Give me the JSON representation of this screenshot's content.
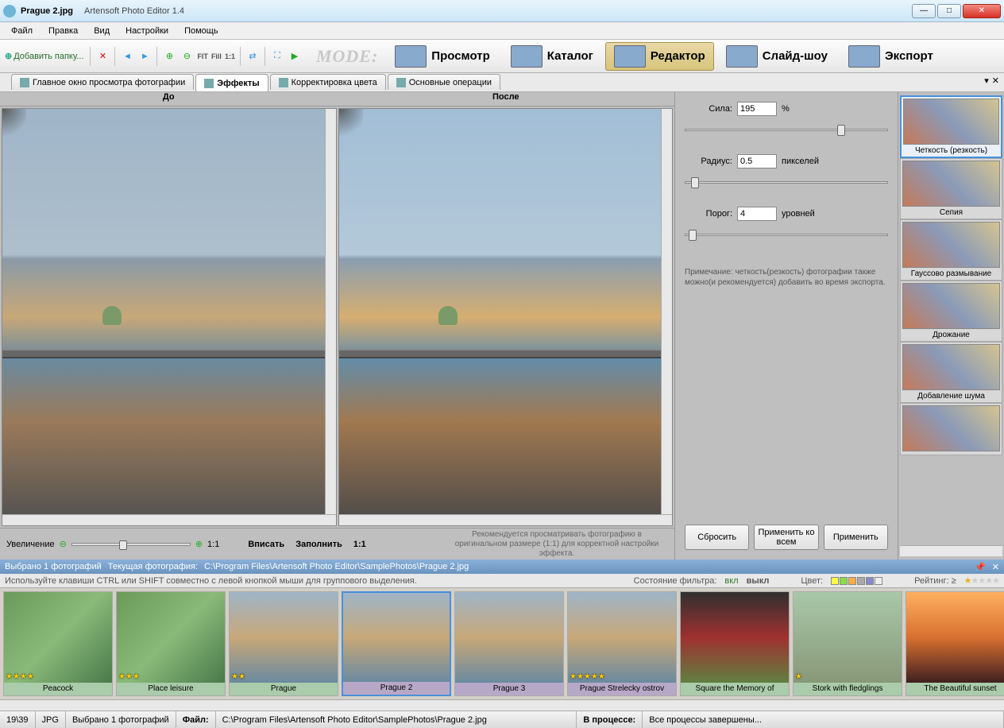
{
  "title": {
    "filename": "Prague 2.jpg",
    "app": "Artensoft Photo Editor 1.4"
  },
  "menu": [
    "Файл",
    "Правка",
    "Вид",
    "Настройки",
    "Помощь"
  ],
  "toolbar": {
    "addfolder": "Добавить папку...",
    "fit": "FIT",
    "fill": "Fill",
    "oneone": "1:1",
    "modelabel": "MODE:",
    "modes": [
      {
        "name": "Просмотр"
      },
      {
        "name": "Каталог"
      },
      {
        "name": "Редактор",
        "active": true
      },
      {
        "name": "Слайд-шоу"
      },
      {
        "name": "Экспорт"
      }
    ]
  },
  "tabs": [
    {
      "label": "Главное окно просмотра фотографии"
    },
    {
      "label": "Эффекты",
      "active": true
    },
    {
      "label": "Корректировка цвета"
    },
    {
      "label": "Основные операции"
    }
  ],
  "preview": {
    "before": "До",
    "after": "После"
  },
  "zoom": {
    "label": "Увеличение",
    "oneone": "1:1",
    "fit": "Вписать",
    "fill": "Заполнить",
    "scale": "1:1",
    "hint": "Рекомендуется просматривать фотографию в оригинальном размере (1:1) для корректной настройки эффекта."
  },
  "controls": {
    "strength": {
      "label": "Сила:",
      "value": "195",
      "unit": "%",
      "pos": 75
    },
    "radius": {
      "label": "Радиус:",
      "value": "0.5",
      "unit": "пикселей",
      "pos": 3
    },
    "threshold": {
      "label": "Порог:",
      "value": "4",
      "unit": "уровней",
      "pos": 2
    },
    "note": "Примечание: четкость(резкость) фотографии также можно(и рекомендуется) добавить во время экспорта.",
    "reset": "Сбросить",
    "applyall": "Применить ко всем",
    "apply": "Применить"
  },
  "effects": [
    {
      "name": "Четкость (резкость)",
      "sel": true
    },
    {
      "name": "Сепия"
    },
    {
      "name": "Гауссово размывание"
    },
    {
      "name": "Дрожание"
    },
    {
      "name": "Добавление шума"
    },
    {
      "name": ""
    }
  ],
  "strip": {
    "header": {
      "selected": "Выбрано 1  фотографий",
      "current": "Текущая фотография:",
      "path": "C:\\Program Files\\Artensoft Photo Editor\\SamplePhotos\\Prague 2.jpg"
    },
    "filter": {
      "hint": "Используйте клавиши CTRL или SHIFT совместно с левой кнопкой мыши для группового выделения.",
      "state": "Состояние фильтра:",
      "on": "вкл",
      "off": "выкл",
      "color": "Цвет:",
      "rating": "Рейтинг: ≥"
    },
    "thumbs": [
      {
        "name": "Peacock",
        "cls": "",
        "stars": "★★★★"
      },
      {
        "name": "Place leisure",
        "cls": "",
        "stars": "★★★"
      },
      {
        "name": "Prague",
        "cls": "city",
        "stars": "★★"
      },
      {
        "name": "Prague 2",
        "cls": "city",
        "sel": true,
        "stars": ""
      },
      {
        "name": "Prague 3",
        "cls": "city",
        "stars": ""
      },
      {
        "name": "Prague Strelecky ostrov",
        "cls": "city",
        "stars": "★★★★★"
      },
      {
        "name": "Square the Memory of",
        "cls": "flowers",
        "stars": ""
      },
      {
        "name": "Stork with fledglings",
        "cls": "bird",
        "stars": "★"
      },
      {
        "name": "The Beautiful sunset",
        "cls": "sunset",
        "stars": ""
      }
    ]
  },
  "status": {
    "counter": "19\\39",
    "format": "JPG",
    "sel": "Выбрано 1 фотографий",
    "filelabel": "Файл:",
    "filepath": "C:\\Program Files\\Artensoft Photo Editor\\SamplePhotos\\Prague 2.jpg",
    "proclabel": "В процессе:",
    "procval": "Все процессы завершены..."
  }
}
